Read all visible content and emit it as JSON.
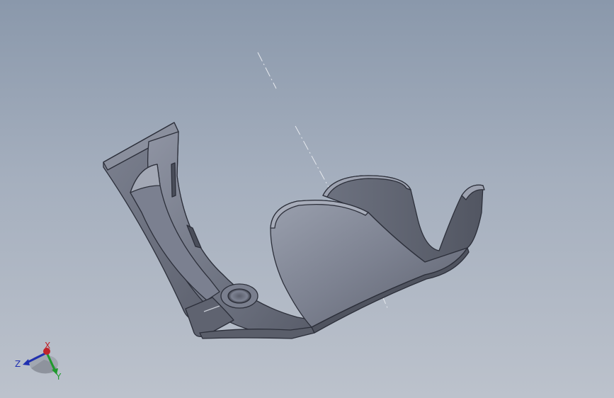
{
  "viewport": {
    "background_top": "#8a98ab",
    "background_bottom": "#bcc2cc"
  },
  "model": {
    "part_color": "#6a6f7d",
    "edge_color": "#2c2f3a",
    "highlight_color": "#9095a3"
  },
  "triad": {
    "x_label": "X",
    "y_label": "Y",
    "z_label": "Z",
    "x_color": "#c0242a",
    "y_color": "#1f9a2c",
    "z_color": "#2030b0"
  }
}
